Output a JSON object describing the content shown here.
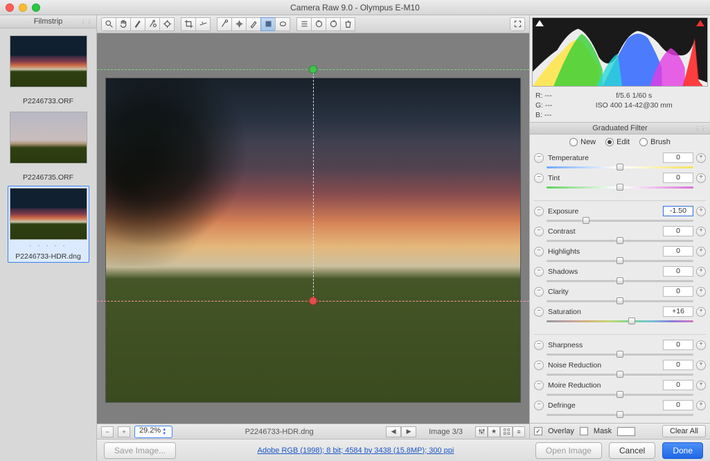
{
  "window": {
    "title": "Camera Raw 9.0  -  Olympus E-M10"
  },
  "filmstrip": {
    "header": "Filmstrip",
    "thumbs": [
      {
        "label": "P2246733.ORF",
        "selected": false
      },
      {
        "label": "P2246735.ORF",
        "selected": false
      },
      {
        "label": "P2246733-HDR.dng",
        "selected": true
      }
    ]
  },
  "center": {
    "zoom": "29.2%",
    "filename": "P2246733-HDR.dng",
    "image_counter": "Image 3/3"
  },
  "histogram_meta": {
    "r": "R:   ---",
    "g": "G:   ---",
    "b": "B:   ---",
    "aperture_shutter": "f/5.6    1/60 s",
    "iso_lens": "ISO 400    14-42@30 mm"
  },
  "panel": {
    "title": "Graduated Filter",
    "modes": {
      "new": "New",
      "edit": "Edit",
      "brush": "Brush",
      "selected": "edit"
    },
    "sliders": [
      {
        "name": "Temperature",
        "value": "0",
        "pos": 50,
        "bar": "temp"
      },
      {
        "name": "Tint",
        "value": "0",
        "pos": 50,
        "bar": "tint"
      },
      {
        "name": "Exposure",
        "value": "-1.50",
        "pos": 27,
        "bar": "plain",
        "highlight": true
      },
      {
        "name": "Contrast",
        "value": "0",
        "pos": 50,
        "bar": "plain"
      },
      {
        "name": "Highlights",
        "value": "0",
        "pos": 50,
        "bar": "plain"
      },
      {
        "name": "Shadows",
        "value": "0",
        "pos": 50,
        "bar": "plain"
      },
      {
        "name": "Clarity",
        "value": "0",
        "pos": 50,
        "bar": "plain"
      },
      {
        "name": "Saturation",
        "value": "+16",
        "pos": 58,
        "bar": "sat"
      },
      {
        "name": "Sharpness",
        "value": "0",
        "pos": 50,
        "bar": "plain"
      },
      {
        "name": "Noise Reduction",
        "value": "0",
        "pos": 50,
        "bar": "plain"
      },
      {
        "name": "Moire Reduction",
        "value": "0",
        "pos": 50,
        "bar": "plain"
      },
      {
        "name": "Defringe",
        "value": "0",
        "pos": 50,
        "bar": "plain"
      }
    ],
    "overlay_label": "Overlay",
    "mask_label": "Mask",
    "clear_label": "Clear All"
  },
  "footer": {
    "save_label": "Save Image...",
    "profile_link": "Adobe RGB (1998); 8 bit; 4584 by 3438 (15.8MP); 300 ppi",
    "open_label": "Open Image",
    "cancel_label": "Cancel",
    "done_label": "Done"
  },
  "icons": {
    "grip": "⋮⋮"
  }
}
